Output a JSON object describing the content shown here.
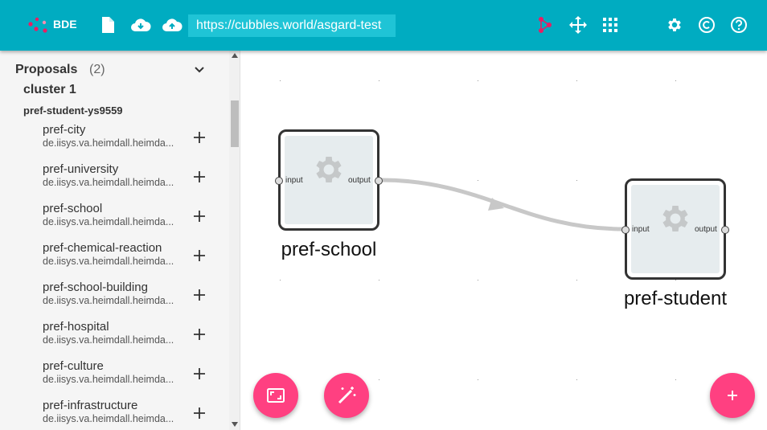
{
  "header": {
    "app_name": "BDE",
    "url": "https://cubbles.world/asgard-test",
    "icons": [
      "new-file-icon",
      "download-cloud-icon",
      "upload-cloud-icon",
      "sitemap-icon",
      "move-arrows-icon",
      "apps-grid-icon",
      "gear-icon",
      "copyright-icon",
      "help-icon"
    ],
    "accent_color": "#00acc1"
  },
  "sidebar": {
    "title": "Proposals",
    "count": "(2)",
    "cluster": "cluster 1",
    "group": "pref-student-ys9559",
    "items": [
      {
        "name": "pref-city",
        "sub": "de.iisys.va.heimdall.heimda..."
      },
      {
        "name": "pref-university",
        "sub": "de.iisys.va.heimdall.heimda..."
      },
      {
        "name": "pref-school",
        "sub": "de.iisys.va.heimdall.heimda..."
      },
      {
        "name": "pref-chemical-reaction",
        "sub": "de.iisys.va.heimdall.heimda..."
      },
      {
        "name": "pref-school-building",
        "sub": "de.iisys.va.heimdall.heimda..."
      },
      {
        "name": "pref-hospital",
        "sub": "de.iisys.va.heimdall.heimda..."
      },
      {
        "name": "pref-culture",
        "sub": "de.iisys.va.heimdall.heimda..."
      },
      {
        "name": "pref-infrastructure",
        "sub": "de.iisys.va.heimdall.heimda..."
      }
    ]
  },
  "canvas": {
    "nodes": [
      {
        "title": "pref-school",
        "input": "input",
        "output": "output"
      },
      {
        "title": "pref-student",
        "input": "input",
        "output": "output"
      }
    ],
    "fab_color": "#ff4081",
    "fabs": [
      "fit-view-icon",
      "auto-layout-wand-icon",
      "add-icon"
    ]
  }
}
